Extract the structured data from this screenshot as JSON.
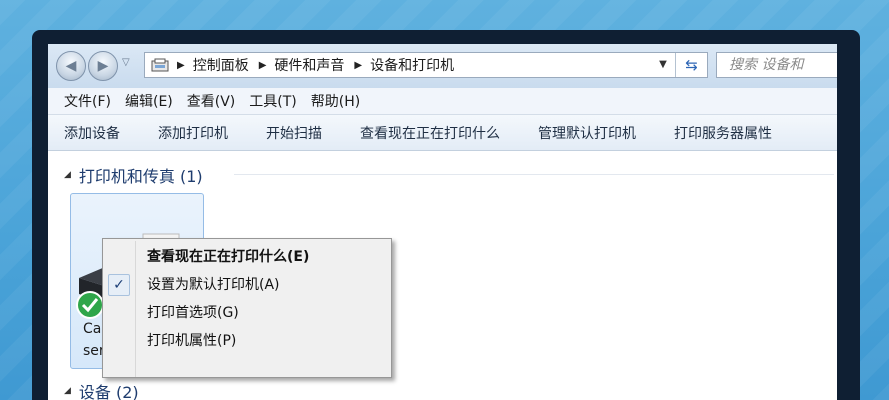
{
  "address_bar": {
    "crumbs": [
      "控制面板",
      "硬件和声音",
      "设备和打印机"
    ],
    "search_placeholder": "搜索 设备和"
  },
  "menu": [
    "文件(F)",
    "编辑(E)",
    "查看(V)",
    "工具(T)",
    "帮助(H)"
  ],
  "commands": [
    "添加设备",
    "添加打印机",
    "开始扫描",
    "查看现在正在打印什么",
    "管理默认打印机",
    "打印服务器属性"
  ],
  "groups": {
    "printers": {
      "title": "打印机和传真 (1)"
    },
    "devices": {
      "title": "设备 (2)"
    }
  },
  "device": {
    "name_line1": "Canon M",
    "name_line2": "series Pr"
  },
  "context_menu": {
    "items": [
      {
        "label": "查看现在正在打印什么(E)",
        "bold": true,
        "checked": false
      },
      {
        "label": "设置为默认打印机(A)",
        "bold": false,
        "checked": true
      },
      {
        "label": "打印首选项(G)",
        "bold": false,
        "checked": false
      },
      {
        "label": "打印机属性(P)",
        "bold": false,
        "checked": false
      }
    ],
    "check_glyph": "✓"
  },
  "colors": {
    "background": "#4aa3d8",
    "window_frame": "#0f1f33",
    "group_title": "#1e3c6e",
    "selection": "#d6e8fa",
    "status_ok": "#2fa64a"
  }
}
